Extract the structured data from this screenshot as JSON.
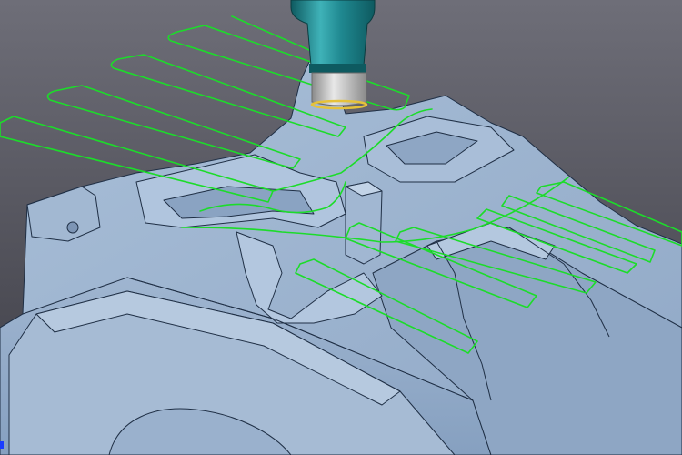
{
  "viewport": {
    "background_top": "#6e6e78",
    "background_bottom": "#3c3c44",
    "corner_marker": "#1a3cff"
  },
  "part": {
    "surface": "#93abc8",
    "surface_light": "#bacde3",
    "surface_mid": "#a5bbd5",
    "surface_dark": "#6f87a6",
    "edge_lines": "#1f2f45"
  },
  "toolpath": {
    "color": "#1cdc2a"
  },
  "tool": {
    "holder": "#1f8890",
    "holder_dark": "#0e5a60",
    "holder_light": "#3fb2b8",
    "collet": "#c7c7c7",
    "collet_dark": "#8a8a8a",
    "tip_ring": "#e6c23a"
  }
}
